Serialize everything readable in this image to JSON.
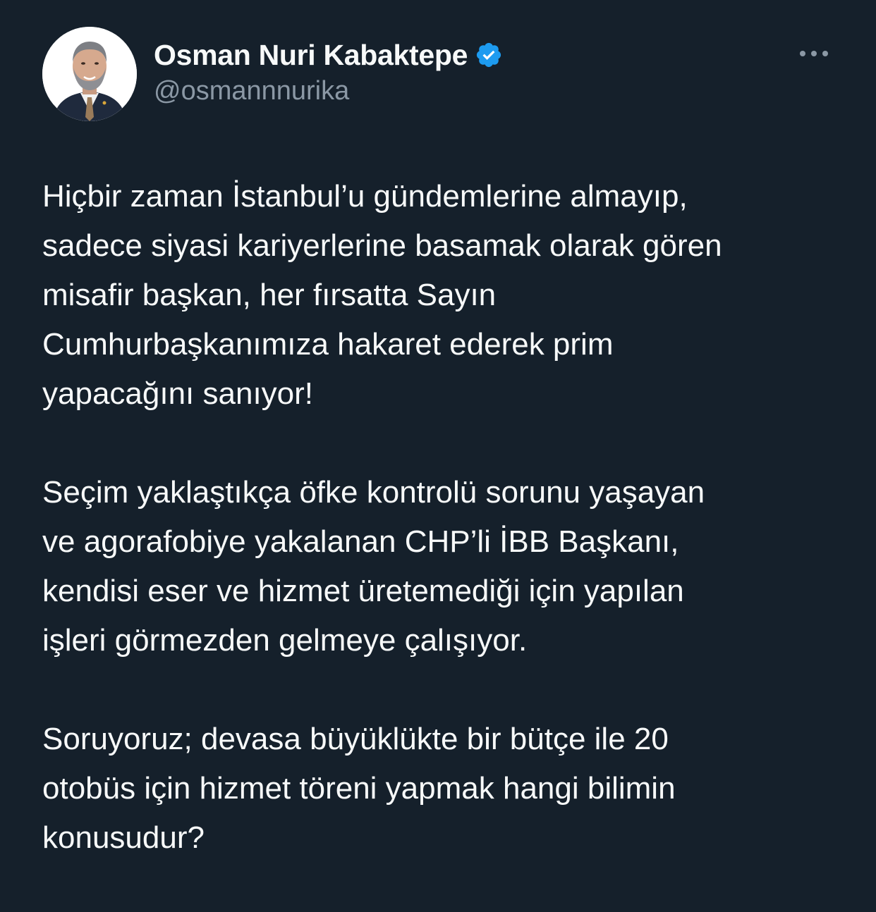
{
  "author": {
    "display_name": "Osman Nuri Kabaktepe",
    "handle": "@osmannnurika",
    "verified": true,
    "verified_color": "#1d9bf0"
  },
  "icons": {
    "verified": "verified-badge-icon",
    "more": "more-horizontal-icon"
  },
  "tweet": {
    "paragraphs": [
      {
        "lines": [
          "Hiçbir zaman İstanbul’u gündemlerine almayıp,",
          "sadece siyasi kariyerlerine basamak olarak gören",
          "misafir başkan, her fırsatta Sayın",
          "Cumhurbaşkanımıza hakaret ederek prim",
          "yapacağını sanıyor!"
        ]
      },
      {
        "lines": [
          "Seçim yaklaştıkça öfke kontrolü sorunu yaşayan",
          "ve agorafobiye yakalanan CHP’li İBB Başkanı,",
          "kendisi eser ve hizmet üretemediği için yapılan",
          "işleri görmezden gelmeye çalışıyor."
        ]
      },
      {
        "lines": [
          "Soruyoruz; devasa büyüklükte bir bütçe ile 20",
          "otobüs için hizmet töreni yapmak hangi bilimin",
          "konusudur?"
        ]
      }
    ]
  },
  "theme": {
    "background": "#15202b",
    "text": "#f7f9f9",
    "secondary_text": "#8b98a5"
  }
}
